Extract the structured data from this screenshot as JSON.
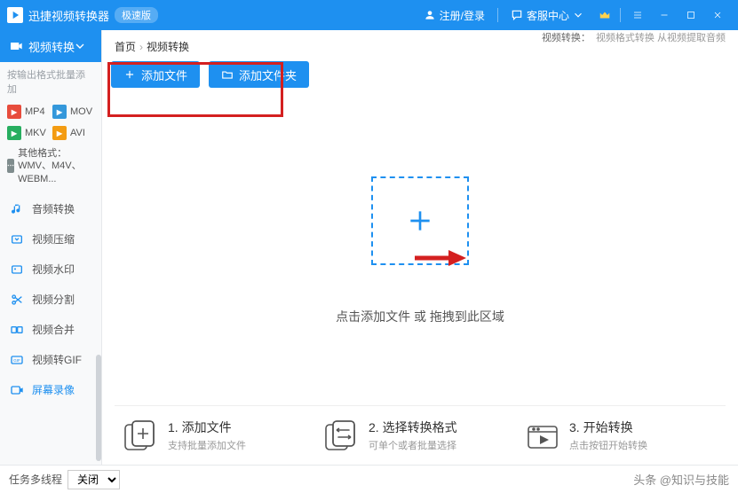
{
  "titlebar": {
    "app_name": "迅捷视频转换器",
    "edition_badge": "极速版",
    "login": "注册/登录",
    "support": "客服中心",
    "vip": "VIP"
  },
  "sidebar": {
    "active_label": "视频转换",
    "section_label": "按输出格式批量添加",
    "formats": {
      "mp4": "MP4",
      "mov": "MOV",
      "mkv": "MKV",
      "avi": "AVI",
      "other": "其他格式：WMV、M4V、WEBM..."
    },
    "items": [
      {
        "key": "audio-convert",
        "label": "音频转换",
        "color": "#1e90f0"
      },
      {
        "key": "video-compress",
        "label": "视频压缩",
        "color": "#1e90f0"
      },
      {
        "key": "video-watermark",
        "label": "视频水印",
        "color": "#1e90f0"
      },
      {
        "key": "video-split",
        "label": "视频分割",
        "color": "#1e90f0"
      },
      {
        "key": "video-merge",
        "label": "视频合并",
        "color": "#1e90f0"
      },
      {
        "key": "video-to-gif",
        "label": "视频转GIF",
        "color": "#1e90f0"
      },
      {
        "key": "screen-record",
        "label": "屏幕录像",
        "color": "#1e90f0"
      }
    ]
  },
  "breadcrumb": {
    "home": "首页",
    "current": "视频转换"
  },
  "subhint": {
    "prefix": "视频转换：",
    "text": "视频格式转换 从视频提取音频"
  },
  "actions": {
    "add_file": "添加文件",
    "add_folder": "添加文件夹"
  },
  "drop": {
    "text": "点击添加文件 或 拖拽到此区域"
  },
  "steps": [
    {
      "title": "1. 添加文件",
      "sub": "支持批量添加文件"
    },
    {
      "title": "2. 选择转换格式",
      "sub": "可单个或者批量选择"
    },
    {
      "title": "3. 开始转换",
      "sub": "点击按钮开始转换"
    }
  ],
  "footer": {
    "label": "任务多线程",
    "selected": "关闭",
    "watermark": "头条 @知识与技能"
  }
}
